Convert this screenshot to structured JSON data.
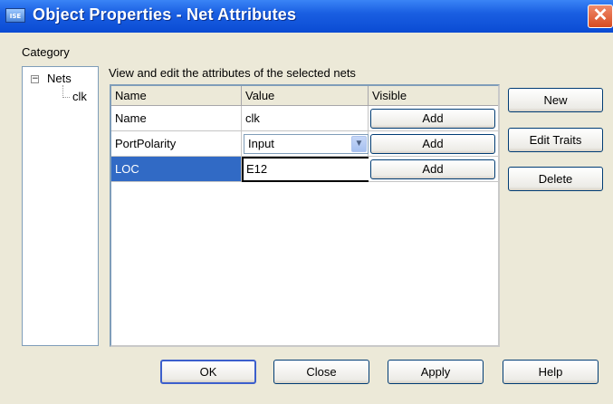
{
  "window": {
    "title": "Object Properties - Net Attributes",
    "icon_text": "ISE",
    "close_glyph": "✕"
  },
  "category": {
    "label": "Category",
    "tree": {
      "root": "Nets",
      "expander": "−",
      "children": [
        "clk"
      ]
    }
  },
  "grid": {
    "caption": "View and edit the attributes of the selected nets",
    "columns": [
      "Name",
      "Value",
      "Visible"
    ],
    "rows": [
      {
        "name": "Name",
        "value": "clk",
        "visible": "Add"
      },
      {
        "name": "PortPolarity",
        "value": "Input",
        "visible": "Add"
      },
      {
        "name": "LOC",
        "value": "E12",
        "visible": "Add"
      }
    ],
    "dropdown_glyph": "▼"
  },
  "side_buttons": {
    "new": "New",
    "edit_traits": "Edit Traits",
    "delete": "Delete"
  },
  "footer_buttons": {
    "ok": "OK",
    "close": "Close",
    "apply": "Apply",
    "help": "Help"
  },
  "colors": {
    "titlebar": "#0a4bd3",
    "selection": "#316ac5",
    "dialog_bg": "#ece9d8"
  }
}
